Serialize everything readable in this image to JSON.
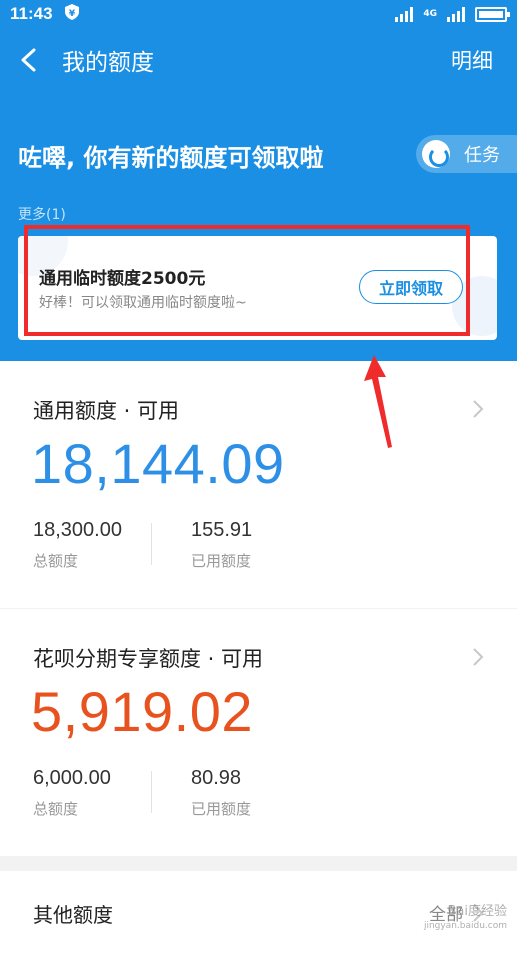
{
  "status_bar": {
    "time": "11:43",
    "network": "4G"
  },
  "header": {
    "title": "我的额度",
    "detail_label": "明细"
  },
  "promo": {
    "heading": "咗噿, 你有新的额度可领取啦",
    "task_label": "任务",
    "more_label": "更多(1)",
    "card_title": "通用临时额度2500元",
    "card_subtitle": "好棒！可以领取通用临时额度啦~",
    "claim_label": "立即领取"
  },
  "general_credit": {
    "title": "通用额度 · 可用",
    "available": "18,144.09",
    "total": "18,300.00",
    "total_label": "总额度",
    "used": "155.91",
    "used_label": "已用额度"
  },
  "installment_credit": {
    "title": "花呗分期专享额度 · 可用",
    "available": "5,919.02",
    "total": "6,000.00",
    "total_label": "总额度",
    "used": "80.98",
    "used_label": "已用额度"
  },
  "other_credit": {
    "title": "其他额度",
    "all_label": "全部"
  },
  "watermark": {
    "line1": "Bai度经验",
    "line2": "jingyan.baidu.com"
  },
  "colors": {
    "brand_blue": "#1a8fe3",
    "amount_blue": "#2d90e6",
    "amount_orange": "#e8521f",
    "annotation_red": "#ef2b2b"
  }
}
